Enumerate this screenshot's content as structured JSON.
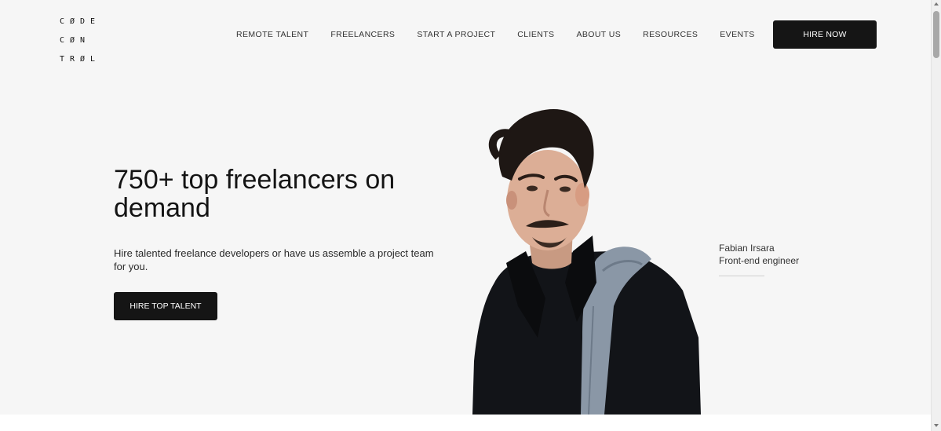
{
  "header": {
    "logo_lines": [
      "CØDE",
      "CØN",
      "TRØL"
    ],
    "nav": [
      "REMOTE TALENT",
      "FREELANCERS",
      "START A PROJECT",
      "CLIENTS",
      "ABOUT US",
      "RESOURCES",
      "EVENTS"
    ],
    "cta_label": "HIRE NOW"
  },
  "hero": {
    "headline": "750+ top freelancers on demand",
    "subtext": "Hire talented freelance developers or have us assemble a project team for you.",
    "cta_label": "HIRE TOP TALENT",
    "featured": {
      "name": "Fabian Irsara",
      "role": "Front-end engineer"
    }
  },
  "colors": {
    "hero_background": "#f6f6f6",
    "button_background": "#151515",
    "button_text": "#ffffff"
  }
}
